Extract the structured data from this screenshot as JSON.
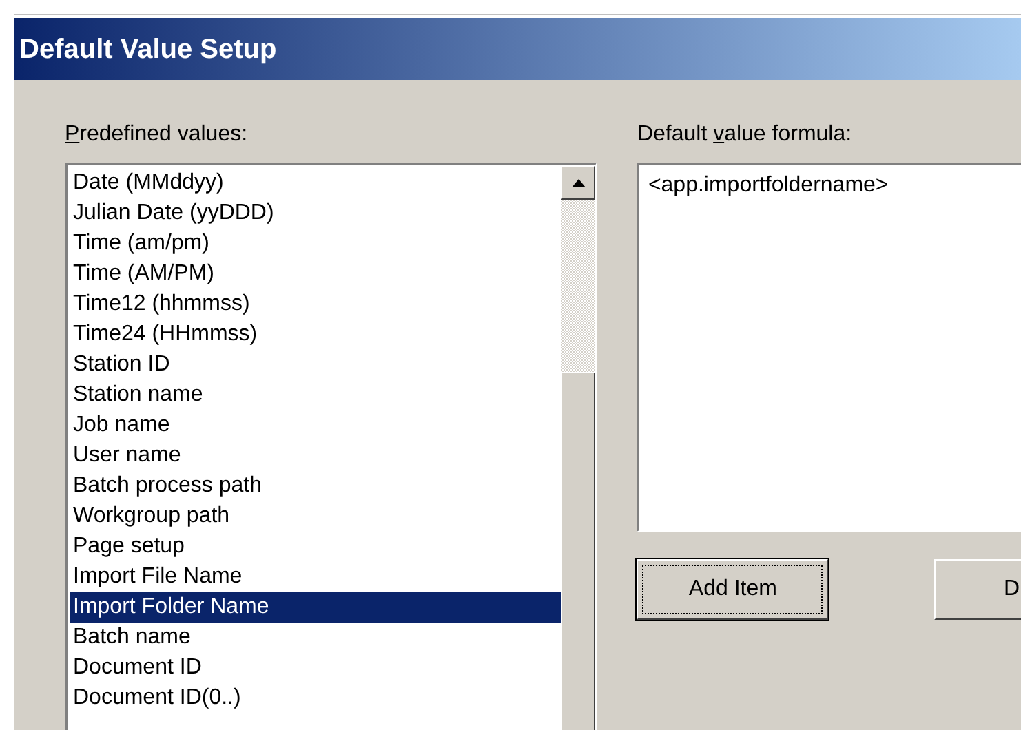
{
  "window": {
    "title": "Default Value Setup"
  },
  "predefined": {
    "label": {
      "key": "P",
      "after": "redefined values:"
    },
    "items": [
      {
        "text": "Date (MMddyy)",
        "selected": false
      },
      {
        "text": "Julian Date (yyDDD)",
        "selected": false
      },
      {
        "text": "Time (am/pm)",
        "selected": false
      },
      {
        "text": "Time (AM/PM)",
        "selected": false
      },
      {
        "text": "Time12 (hhmmss)",
        "selected": false
      },
      {
        "text": "Time24 (HHmmss)",
        "selected": false
      },
      {
        "text": "Station ID",
        "selected": false
      },
      {
        "text": "Station name",
        "selected": false
      },
      {
        "text": "Job name",
        "selected": false
      },
      {
        "text": "User name",
        "selected": false
      },
      {
        "text": "Batch process path",
        "selected": false
      },
      {
        "text": "Workgroup path",
        "selected": false
      },
      {
        "text": "Page setup",
        "selected": false
      },
      {
        "text": "Import File Name",
        "selected": false
      },
      {
        "text": "Import Folder Name",
        "selected": true
      },
      {
        "text": "Batch name",
        "selected": false
      },
      {
        "text": "Document ID",
        "selected": false
      },
      {
        "text": "Document ID(0..)",
        "selected": false
      }
    ]
  },
  "formula": {
    "label": {
      "before": "Default ",
      "key": "v",
      "after": "alue formula:"
    },
    "value": "<app.importfoldername>"
  },
  "buttons": [
    {
      "label": "Add Item",
      "focused": true
    },
    {
      "label": "D",
      "focused": false
    }
  ]
}
